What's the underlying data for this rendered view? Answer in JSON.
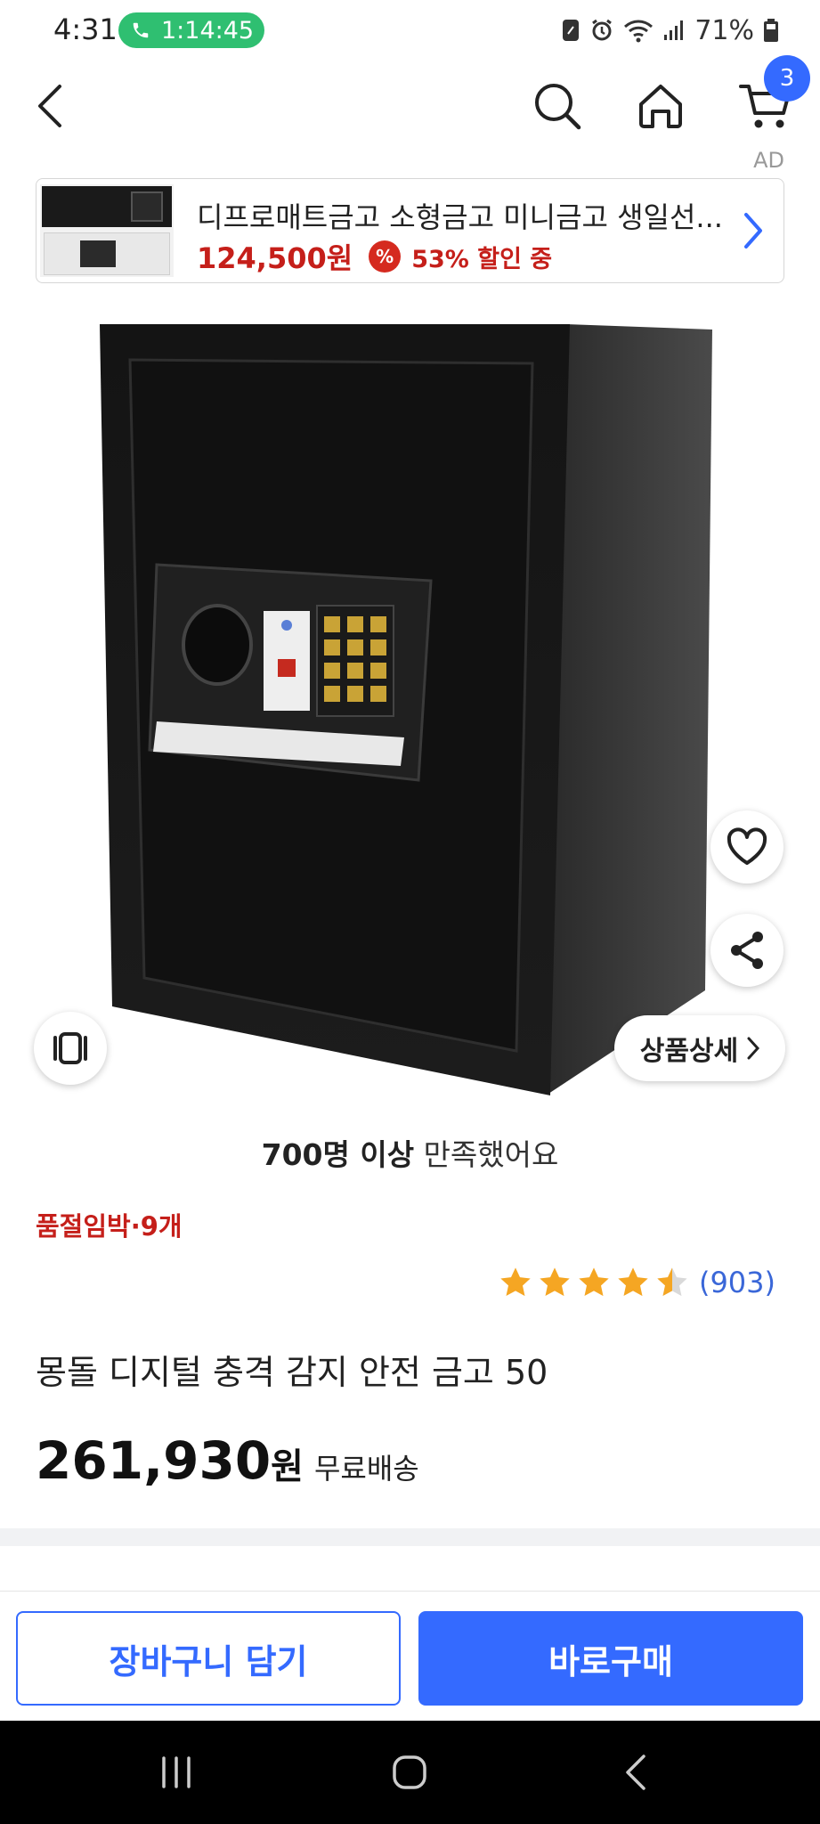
{
  "status_bar": {
    "time": "4:31",
    "call_duration": "1:14:45",
    "battery": "71%"
  },
  "nav": {
    "cart_count": "3",
    "icons": [
      "back-icon",
      "search-icon",
      "home-icon",
      "cart-icon"
    ]
  },
  "ad": {
    "label": "AD",
    "title": "디프로매트금고 소형금고 미니금고 생일선...",
    "price": "124,500원",
    "discount_text": "53% 할인 중",
    "discount_icon_text": "%"
  },
  "image_overlay": {
    "detail_label": "상품상세"
  },
  "satisfaction": {
    "bold": "700명 이상",
    "rest": " 만족했어요"
  },
  "stock": "품절임박·9개",
  "rating": {
    "value": 4.5,
    "count": "(903)"
  },
  "product": {
    "title": "몽돌 디지털 충격 감지 안전 금고 50",
    "price": "261,930",
    "currency": "원",
    "shipping": "무료배송"
  },
  "actions": {
    "add_to_cart": "장바구니 담기",
    "buy_now": "바로구매"
  },
  "colors": {
    "accent": "#346aff",
    "sale_red": "#c51f1a",
    "star": "#f5a623"
  }
}
